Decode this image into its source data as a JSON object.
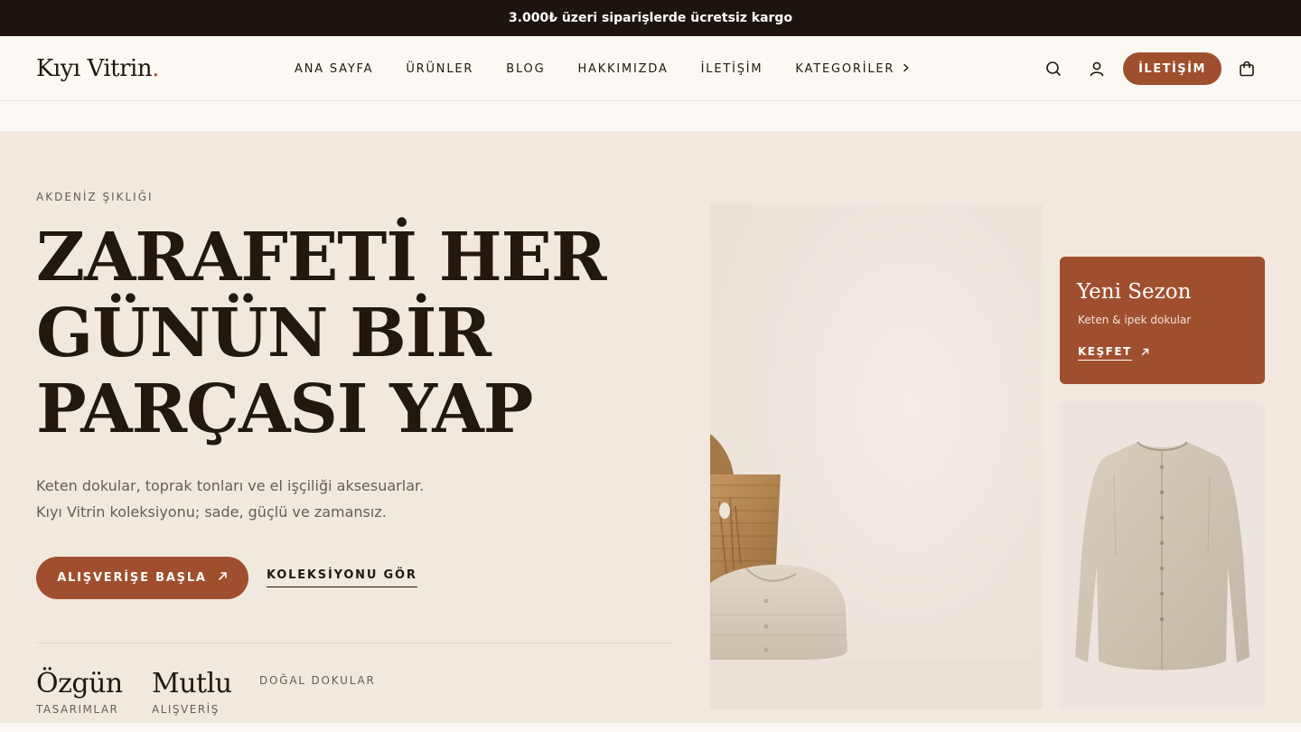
{
  "announcement": "3.000₺ üzeri siparişlerde ücretsiz kargo",
  "brand": {
    "name": "Kıyı Vitrin",
    "dot": "."
  },
  "nav": {
    "items": [
      {
        "label": "ANA SAYFA"
      },
      {
        "label": "ÜRÜNLER"
      },
      {
        "label": "BLOG"
      },
      {
        "label": "HAKKIMIZDA"
      },
      {
        "label": "İLETİŞİM"
      },
      {
        "label": "KATEGORİLER"
      }
    ],
    "contact_button": "İLETİŞİM"
  },
  "hero": {
    "eyebrow": "AKDENİZ ŞIKLIĞI",
    "headline": [
      "ZARAFETİ HER",
      "GÜNÜN BİR",
      "PARÇASI YAP"
    ],
    "subtext": "Keten dokular, toprak tonları ve el işçiliği aksesuarlar. Kıyı Vitrin koleksiyonu; sade, güçlü ve zamansız.",
    "cta_primary": "ALIŞVERİŞE BAŞLA",
    "cta_secondary": "KOLEKSİYONU GÖR",
    "stats": [
      {
        "big": "Özgün",
        "small": "TASARIMLAR"
      },
      {
        "big": "Mutlu",
        "small": "ALIŞVERİŞ"
      }
    ],
    "stat_tag": "DOĞAL DOKULAR"
  },
  "promo_card": {
    "title": "Yeni Sezon",
    "subtitle": "Keten & ipek dokular",
    "link": "KEŞFET"
  },
  "colors": {
    "accent": "#a04f2e",
    "topbar": "#1e140f",
    "hero_bg": "#f1e9e0",
    "header_bg": "#fcf8f3"
  }
}
